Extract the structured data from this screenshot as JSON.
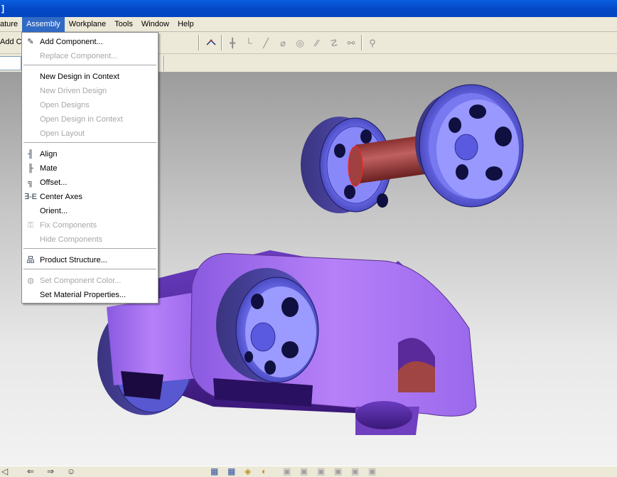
{
  "window": {
    "title_fragment": "]"
  },
  "menubar": {
    "items": [
      "ature",
      "Assembly",
      "Workplane",
      "Tools",
      "Window",
      "Help"
    ],
    "active": "Assembly"
  },
  "toolbar": {
    "add_component_label": "Add Co"
  },
  "assembly_menu": {
    "items": [
      {
        "label": "Add Component...",
        "enabled": true,
        "icon": "add-component-icon"
      },
      {
        "label": "Replace Component...",
        "enabled": false
      },
      {
        "label": "New Design in Context",
        "enabled": true
      },
      {
        "label": "New Driven Design",
        "enabled": false
      },
      {
        "label": "Open Designs",
        "enabled": false
      },
      {
        "label": "Open Design in Context",
        "enabled": false
      },
      {
        "label": "Open Layout",
        "enabled": false
      },
      {
        "label": "Align",
        "enabled": true,
        "icon": "align-icon"
      },
      {
        "label": "Mate",
        "enabled": true,
        "icon": "mate-icon"
      },
      {
        "label": "Offset...",
        "enabled": true,
        "icon": "offset-icon"
      },
      {
        "label": "Center Axes",
        "enabled": true,
        "icon": "center-axes-icon"
      },
      {
        "label": "Orient...",
        "enabled": true
      },
      {
        "label": "Fix Components",
        "enabled": false,
        "icon": "fix-components-icon"
      },
      {
        "label": "Hide Components",
        "enabled": false
      },
      {
        "label": "Product Structure...",
        "enabled": true,
        "icon": "product-structure-icon"
      },
      {
        "label": "Set Component Color...",
        "enabled": false,
        "icon": "color-icon"
      },
      {
        "label": "Set Material Properties...",
        "enabled": true
      }
    ]
  },
  "colors": {
    "titlebar": "#0449c8",
    "menu_highlight": "#316ac5",
    "part_purple": "#a070f0",
    "wheel_blue": "#6a6af0",
    "axle_red": "#b04a48"
  }
}
